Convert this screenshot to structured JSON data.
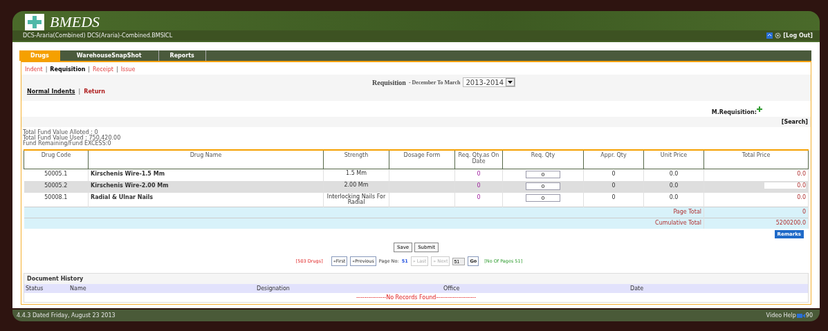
{
  "header": {
    "app_name": "BMEDS",
    "location": "DCS-Araria(Combined)   DCS(Araria)-Combined.BMSICL",
    "logout": "[Log Out]"
  },
  "tabs": [
    {
      "label": "Drugs",
      "selected": true
    },
    {
      "label": "WarehouseSnapShot",
      "selected": false
    },
    {
      "label": "Reports",
      "selected": false
    }
  ],
  "subnav": [
    {
      "label": "Indent",
      "selected": false
    },
    {
      "separator": "|",
      "label": "Requisition",
      "selected": true
    },
    {
      "separator": "|",
      "label": "Receipt",
      "selected": false
    },
    {
      "separator": "|",
      "label": "Issue",
      "selected": false
    }
  ],
  "title": {
    "text": "Requisition",
    "period": "- December To March",
    "year": "2013-2014"
  },
  "indent_nav": [
    {
      "label": "Normal Indents",
      "selected": true
    },
    {
      "separator": "|",
      "label": "Return",
      "selected": false
    }
  ],
  "m_requisition": "M.Requisition:",
  "search_link": "[Search]",
  "fund": [
    "Total Fund Value Alloted : 0",
    "Total Fund Value Used : 750,420.00",
    "Fund Remaining/Fund EXCESS:0"
  ],
  "table": {
    "columns": [
      "Drug Code",
      "Drug Name",
      "Strength",
      "Dosage Form",
      "Req. Qty.as On Date",
      "Req. Qty",
      "Appr. Qty",
      "Unit Price",
      "Total Price"
    ],
    "rows": [
      {
        "code": "50005.1",
        "name": "Kirschenis Wire-1.5 Mm",
        "strength": "1.5 Mm",
        "req_on_date": "0",
        "req_qty": "0",
        "appr_qty": "0",
        "unit_price": "0.0",
        "total_price": "0.0",
        "selected": false
      },
      {
        "code": "50005.2",
        "name": "Kirschenis Wire-2.00 Mm",
        "strength": "2.00 Mm",
        "req_on_date": "0",
        "req_qty": "0",
        "appr_qty": "0",
        "unit_price": "0.0",
        "total_price": "0.0",
        "selected": true
      },
      {
        "code": "50008.1",
        "name": "Radial & Ulnar Nails",
        "strength": "Interlocking Nails For Radial",
        "req_on_date": "0",
        "req_qty": "0",
        "appr_qty": "0",
        "unit_price": "0.0",
        "total_price": "0.0",
        "selected": false
      }
    ],
    "totals": [
      {
        "label": "Page Total",
        "value": "0"
      },
      {
        "label": "Cumulative Total",
        "value": "5200200.0"
      }
    ]
  },
  "remarks_button": "Remarks",
  "buttons": [
    "Save",
    "Submit"
  ],
  "pager": {
    "count": "[503 Drugs]",
    "first": {
      "label": "«First",
      "disabled": false
    },
    "previous": {
      "label": "«Previous",
      "disabled": false
    },
    "page_label": "Page No:",
    "page": "51",
    "last": {
      "label": "» Last",
      "disabled": true
    },
    "next": {
      "label": "» Next",
      "disabled": true
    },
    "page_input": "51",
    "go": "Go",
    "pages": "[No Of Pages 51]"
  },
  "history": {
    "title": "Document History",
    "columns": [
      "Status",
      "Name",
      "Designation",
      "Office",
      "Date"
    ],
    "empty": "---------------No Records Found--------------------"
  },
  "footer": {
    "version": "4.4.3 Dated Friday, August 23 2013",
    "help": "Video Help",
    "help_count": "90"
  }
}
